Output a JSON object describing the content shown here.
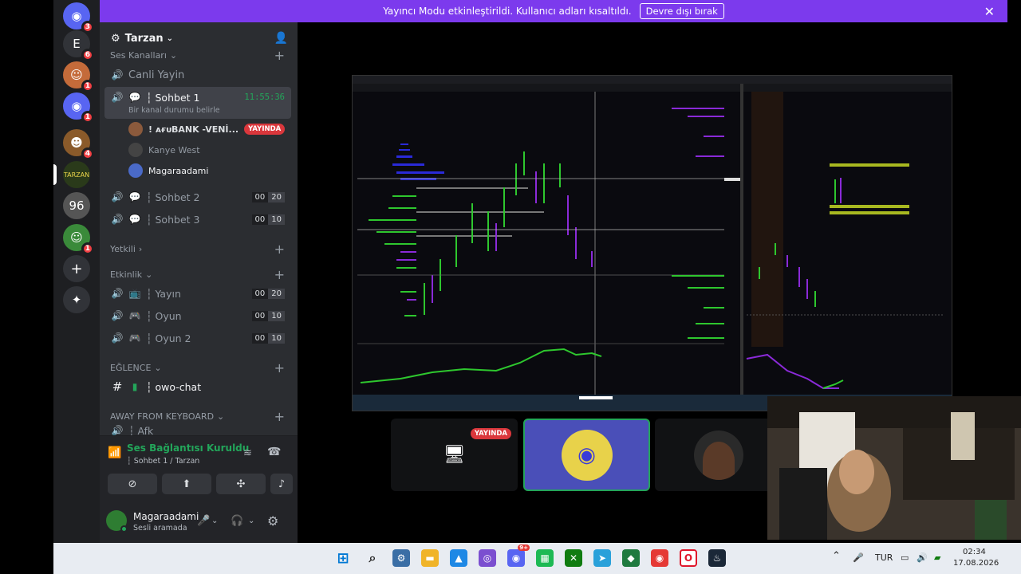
{
  "banner": {
    "text": "Yayıncı Modu etkinleştirildi. Kullanıcı adları kısaltıldı.",
    "button": "Devre dışı bırak"
  },
  "rail": {
    "badges": [
      "3",
      "6",
      "1",
      "1",
      "4",
      "1"
    ]
  },
  "server": {
    "name": "Tarzan"
  },
  "categories": {
    "voice": "Ses Kanalları",
    "yetkili": "Yetkili",
    "etkinlik": "Etkinlik",
    "eglence": "EĞLENCE",
    "afk": "AWAY FROM KEYBOARD"
  },
  "channels": {
    "canli": "Canli Yayin",
    "sohbet1": {
      "name": "┆ Sohbet 1",
      "timer": "11:55:36",
      "status": "Bir kanal durumu belirle"
    },
    "sohbet2": {
      "name": "┆ Sohbet 2",
      "count": "00",
      "limit": "20"
    },
    "sohbet3": {
      "name": "┆ Sohbet 3",
      "count": "00",
      "limit": "10"
    },
    "yayin": {
      "name": "┆ Yayın",
      "count": "00",
      "limit": "20"
    },
    "oyun": {
      "name": "┆ Oyun",
      "count": "00",
      "limit": "10"
    },
    "oyun2": {
      "name": "┆ Oyun 2",
      "count": "00",
      "limit": "10"
    },
    "owo": "┆ owo-chat",
    "afk": "┆ Afk"
  },
  "members": [
    {
      "name": "! ᴀғᴜBANK -VENİ...",
      "live": "YAYINDA"
    },
    {
      "name": "Kanye West"
    },
    {
      "name": "Magaraadami"
    }
  ],
  "voice_panel": {
    "title": "Ses Bağlantısı Kuruldu",
    "sub": "┆ Sohbet 1 / Tarzan"
  },
  "user_panel": {
    "name": "Magaraadami",
    "status": "Sesli aramada"
  },
  "stage": {
    "live": "YAYINDA"
  },
  "taskbar": {
    "lang": "TUR",
    "time": "02:34",
    "date": "17.08.2026",
    "discord_badge": "9+"
  },
  "colors": {
    "accent": "#7c3aed",
    "live": "#da373c",
    "online": "#23a55a"
  }
}
